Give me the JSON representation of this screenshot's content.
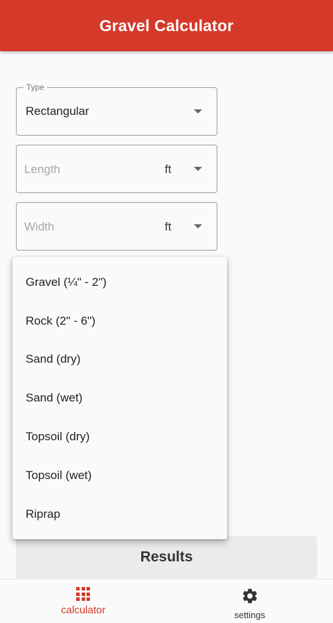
{
  "appbar": {
    "title": "Gravel Calculator"
  },
  "fields": {
    "type": {
      "legend": "Type",
      "value": "Rectangular"
    },
    "length": {
      "placeholder": "Length",
      "unit": "ft"
    },
    "width": {
      "placeholder": "Width",
      "unit": "ft"
    }
  },
  "material_menu": {
    "items": [
      {
        "label": "Gravel (¼\" - 2\")"
      },
      {
        "label": "Rock (2\" - 6\")"
      },
      {
        "label": "Sand (dry)"
      },
      {
        "label": "Sand (wet)"
      },
      {
        "label": "Topsoil (dry)"
      },
      {
        "label": "Topsoil (wet)"
      },
      {
        "label": "Riprap"
      }
    ]
  },
  "results": {
    "label": "Results"
  },
  "bottom_nav": {
    "calculator": {
      "label": "calculator",
      "icon": "grid-icon"
    },
    "settings": {
      "label": "settings",
      "icon": "gear-icon"
    }
  },
  "colors": {
    "accent": "#d5392a",
    "background": "#fafafa"
  }
}
